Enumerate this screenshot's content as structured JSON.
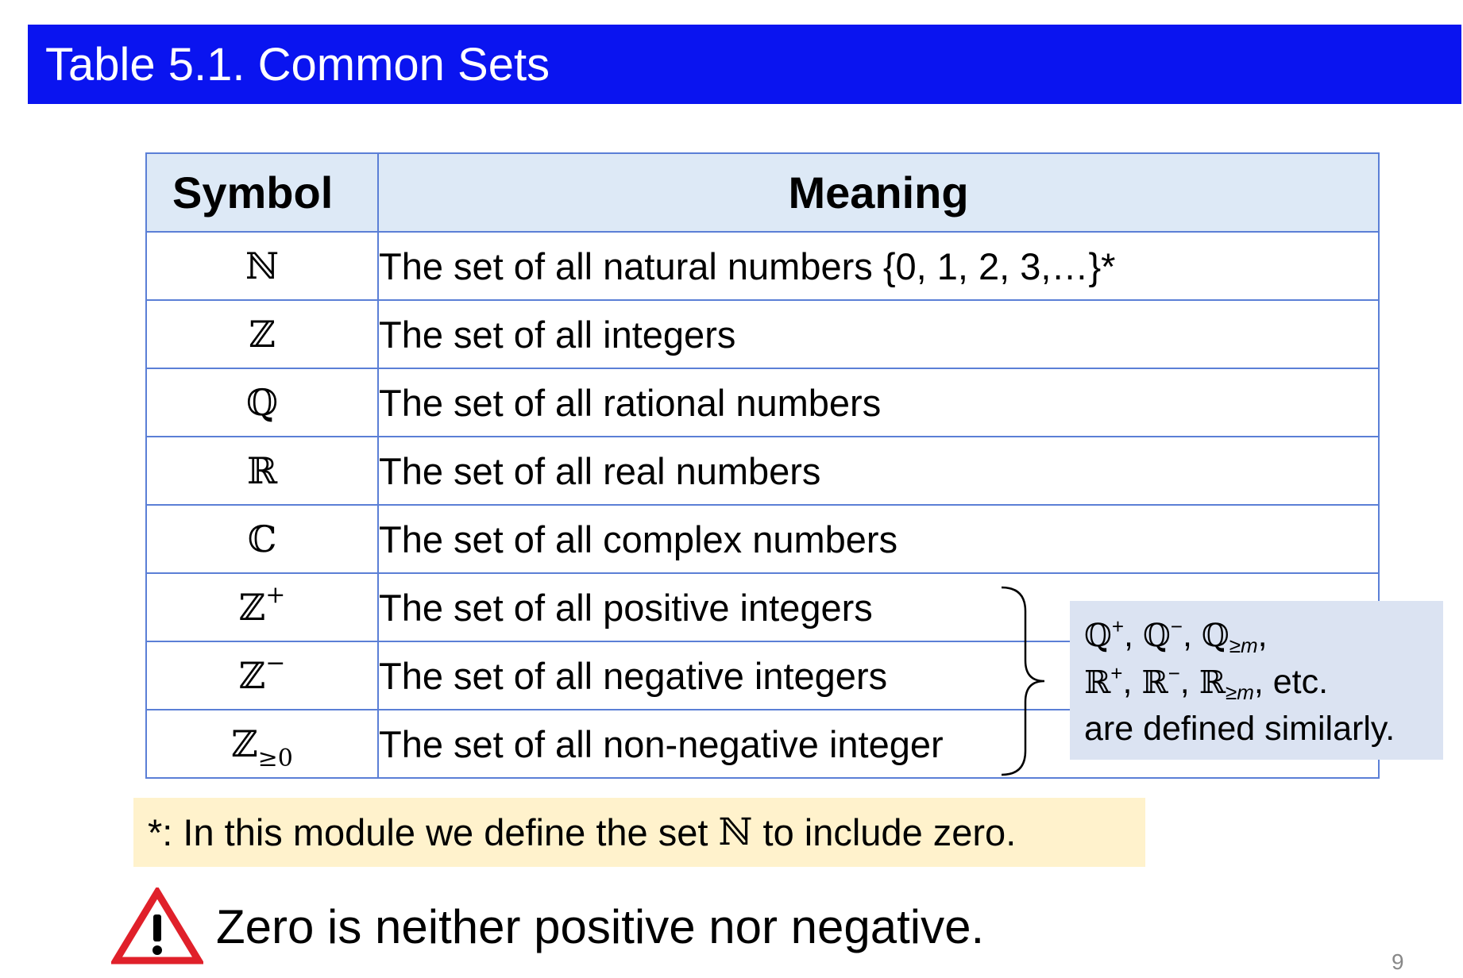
{
  "slide": {
    "title": "Table 5.1. Common Sets",
    "page_number": "9"
  },
  "table": {
    "headers": {
      "symbol": "Symbol",
      "meaning": "Meaning"
    },
    "rows": [
      {
        "symbol": "ℕ",
        "sup": "",
        "sub": "",
        "meaning": "The set of all natural numbers {0, 1, 2, 3,…}*"
      },
      {
        "symbol": "ℤ",
        "sup": "",
        "sub": "",
        "meaning": "The set of all integers"
      },
      {
        "symbol": "ℚ",
        "sup": "",
        "sub": "",
        "meaning": "The set of all rational numbers"
      },
      {
        "symbol": "ℝ",
        "sup": "",
        "sub": "",
        "meaning": "The set of all real numbers"
      },
      {
        "symbol": "ℂ",
        "sup": "",
        "sub": "",
        "meaning": "The set of all complex numbers"
      },
      {
        "symbol": "ℤ",
        "sup": "+",
        "sub": "",
        "meaning": "The set of all positive integers"
      },
      {
        "symbol": "ℤ",
        "sup": "−",
        "sub": "",
        "meaning": "The set of all negative integers"
      },
      {
        "symbol": "ℤ",
        "sup": "",
        "sub": "≥0",
        "meaning": "The set of all non-negative integer"
      }
    ]
  },
  "callout": {
    "line1": {
      "a": "ℚ",
      "a_sup": "+",
      "b": "ℚ",
      "b_sup": "−",
      "c": "ℚ",
      "c_sub": "≥m",
      "tail": ","
    },
    "line2": {
      "a": "ℝ",
      "a_sup": "+",
      "b": "ℝ",
      "b_sup": "−",
      "c": "ℝ",
      "c_sub": "≥m",
      "tail": ", etc."
    },
    "line3": "are defined similarly."
  },
  "footnote": {
    "before": "*: In this module we define the set ",
    "symbol": "ℕ",
    "after": " to include zero."
  },
  "warning": {
    "text": "Zero is neither positive nor negative.",
    "icon": "warning-triangle-icon",
    "icon_color": "#e0202a"
  },
  "colors": {
    "title_bar": "#0a14f0",
    "table_header": "#dde9f6",
    "table_border": "#5b7fd6",
    "callout_bg": "#dbe3f2",
    "footnote_bg": "#fff2cc"
  }
}
